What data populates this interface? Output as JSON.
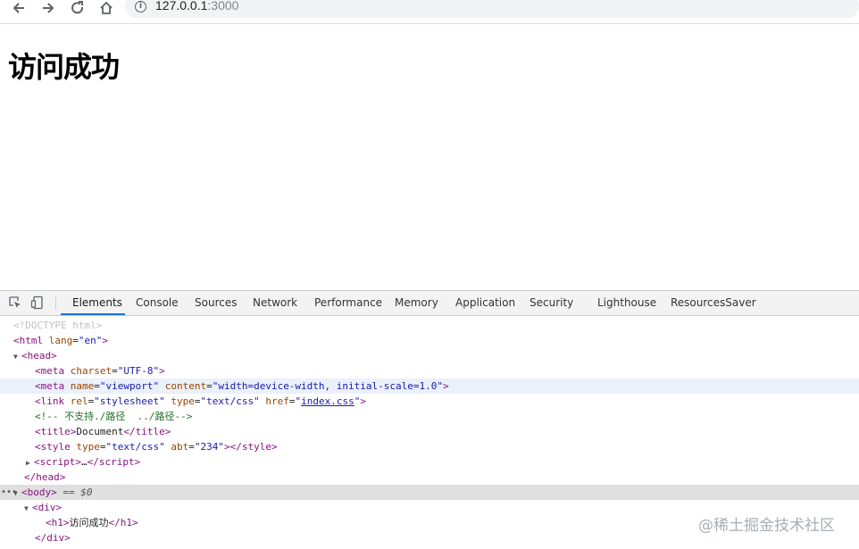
{
  "browser": {
    "url_host": "127.0.0.1",
    "url_port": ":3000",
    "back_icon": "arrow-left-icon",
    "forward_icon": "arrow-right-icon",
    "reload_icon": "reload-icon",
    "home_icon": "home-icon",
    "info_icon": "info-icon"
  },
  "page": {
    "heading": "访问成功"
  },
  "devtools": {
    "tabs": [
      "Elements",
      "Console",
      "Sources",
      "Network",
      "Performance",
      "Memory",
      "Application",
      "Security",
      "Lighthouse",
      "ResourcesSaver"
    ],
    "active_tab": "Elements",
    "accent": "#1a73e8",
    "tree": {
      "doctype": "<!DOCTYPE html>",
      "html_open": "html",
      "html_lang_attr": "lang",
      "html_lang_val": "\"en\"",
      "head": "head",
      "meta1_attr": "charset",
      "meta1_val": "\"UTF-8\"",
      "meta2_name_attr": "name",
      "meta2_name_val": "\"viewport\"",
      "meta2_content_attr": "content",
      "meta2_content_val": "\"width=device-width, initial-scale=1.0\"",
      "link_rel_attr": "rel",
      "link_rel_val": "\"stylesheet\"",
      "link_type_attr": "type",
      "link_type_val": "\"text/css\"",
      "link_href_attr": "href",
      "link_href_val": "index.css",
      "comment": "<!-- 不支持./路径  ../路径-->",
      "title_text": "Document",
      "style_type_attr": "type",
      "style_type_val": "\"text/css\"",
      "style_abt_attr": "abt",
      "style_abt_val": "\"234\"",
      "script_ellipsis": "…",
      "body_selected_suffix": "== $0",
      "h1_text": "访问成功"
    }
  },
  "watermark": "@稀土掘金技术社区"
}
